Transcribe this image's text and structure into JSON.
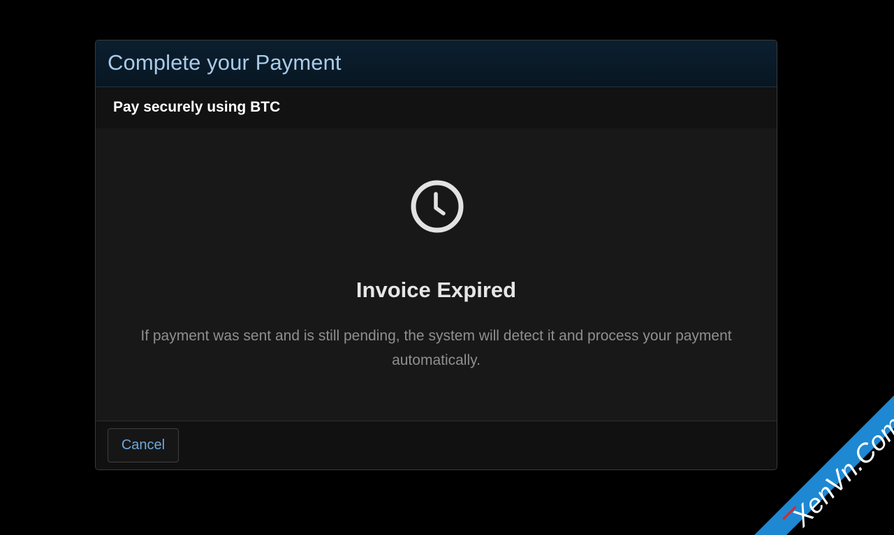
{
  "modal": {
    "title": "Complete your Payment",
    "subtitle": "Pay securely using BTC"
  },
  "status": {
    "icon": "clock-icon",
    "title": "Invoice Expired",
    "message": "If payment was sent and is still pending, the system will detect it and process your payment automatically."
  },
  "footer": {
    "cancel_label": "Cancel"
  },
  "watermark": {
    "text": "XenVn.Com",
    "color": "#1e88d2"
  },
  "colors": {
    "title": "#a9cbe8",
    "link": "#6ea8dc",
    "background": "#000000",
    "panel": "#181818"
  }
}
